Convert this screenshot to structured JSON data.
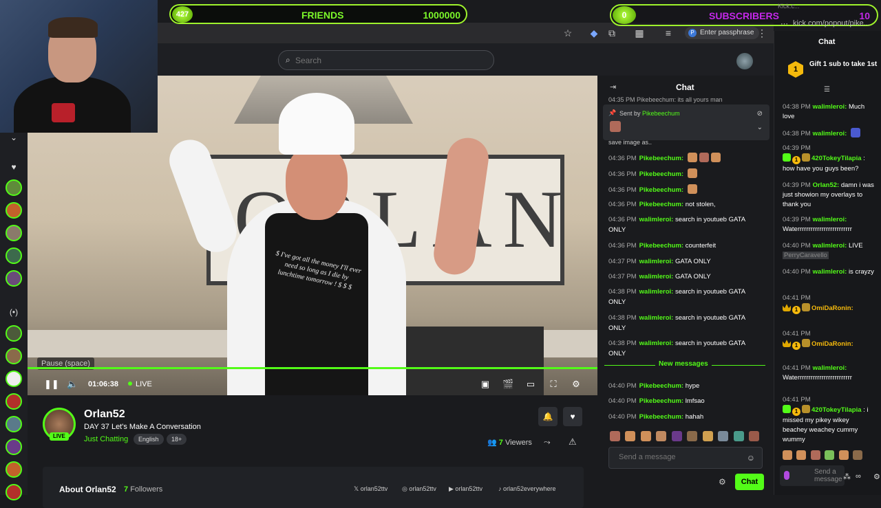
{
  "overlay": {
    "friends": {
      "badge": "427",
      "label": "FRIENDS",
      "goal": "1000000"
    },
    "subscribers": {
      "badge": "0",
      "label": "SUBSCRIBERS",
      "goal": "10"
    }
  },
  "browser": {
    "passphrase_label": "Enter passphrase",
    "popout_url": "kick.com/popout/pike...",
    "mini_tab": "Kick.c..."
  },
  "header": {
    "search_placeholder": "Search"
  },
  "player": {
    "tooltip": "Pause (space)",
    "time": "01:06:38",
    "live_label": "LIVE",
    "apron_text": "$ I've got all the money I'll ever need so long as I die by lunchtime tomorrow ! $ $ $",
    "sign_text": "ORLAN",
    "progress_percent": 100
  },
  "channel": {
    "name": "Orlan52",
    "live_pill": "LIVE",
    "title": "DAY 37 Let's Make A Conversation",
    "category": "Just Chatting",
    "tags": [
      "English",
      "18+"
    ],
    "viewers_count": "7",
    "viewers_label": "Viewers",
    "about_label": "About Orlan52",
    "followers_count": "7",
    "followers_label": "Followers",
    "socials": [
      {
        "icon": "x-icon",
        "handle": "orlan52ttv"
      },
      {
        "icon": "instagram-icon",
        "handle": "orlan52ttv"
      },
      {
        "icon": "youtube-icon",
        "handle": "orlan52ttv"
      },
      {
        "icon": "tiktok-icon",
        "handle": "orlan52everywhere"
      }
    ]
  },
  "inner_chat": {
    "title": "Chat",
    "top_line": "04:35 PM Pikebeechum: its all yours man",
    "pinned_prefix": "Sent by",
    "pinned_user": "Pikebeechum",
    "save_text": "save image as..",
    "messages": [
      {
        "time": "04:36 PM",
        "user": "Pikebeechum:",
        "text": "",
        "emotes": 3
      },
      {
        "time": "04:36 PM",
        "user": "Pikebeechum:",
        "text": "",
        "emotes": 1
      },
      {
        "time": "04:36 PM",
        "user": "Pikebeechum:",
        "text": "",
        "emotes": 1
      },
      {
        "time": "04:36 PM",
        "user": "Pikebeechum:",
        "text": "not stolen,",
        "emotes": 0
      },
      {
        "time": "04:36 PM",
        "user": "walimleroi:",
        "text": "search in youtueb GATA ONLY",
        "emotes": 0
      },
      {
        "time": "04:36 PM",
        "user": "Pikebeechum:",
        "text": "counterfeit",
        "emotes": 0
      },
      {
        "time": "04:37 PM",
        "user": "walimleroi:",
        "text": "GATA ONLY",
        "emotes": 0
      },
      {
        "time": "04:37 PM",
        "user": "walimleroi:",
        "text": "GATA ONLY",
        "emotes": 0
      },
      {
        "time": "04:38 PM",
        "user": "walimleroi:",
        "text": "search in youtueb GATA ONLY",
        "emotes": 0
      },
      {
        "time": "04:38 PM",
        "user": "walimleroi:",
        "text": "search in youtueb GATA ONLY",
        "emotes": 0
      },
      {
        "time": "04:38 PM",
        "user": "walimleroi:",
        "text": "search in youtueb GATA ONLY",
        "emotes": 0
      }
    ],
    "new_messages_label": "New messages",
    "new_messages": [
      {
        "time": "04:40 PM",
        "user": "Pikebeechum:",
        "text": "hype"
      },
      {
        "time": "04:40 PM",
        "user": "Pikebeechum:",
        "text": "lmfsao"
      },
      {
        "time": "04:40 PM",
        "user": "Pikebeechum:",
        "text": "hahah"
      }
    ],
    "input_placeholder": "Send a message",
    "send_label": "Chat"
  },
  "popout_chat": {
    "title": "Chat",
    "gift_badge": "1",
    "gift_text": "Gift 1 sub to take 1st",
    "messages": [
      {
        "time": "04:38 PM",
        "user": "walimleroi:",
        "text": "Much love"
      },
      {
        "time": "04:38 PM",
        "user": "walimleroi:",
        "text": ""
      },
      {
        "time": "04:39 PM",
        "user": "420TokeyTilapia",
        "text": ": how have you guys been?"
      },
      {
        "time": "04:39 PM",
        "user": "Orlan52:",
        "text": "damn i was just showion my overlays to thank you"
      },
      {
        "time": "04:39 PM",
        "user": "walimleroi:",
        "text": "Waterrrrrrrrrrrrrrrrrrrrrrrrr"
      },
      {
        "time": "04:40 PM",
        "user": "walimleroi:",
        "text": "LIVE",
        "highlight": "PerryCaravello"
      },
      {
        "time": "04:40 PM",
        "user": "walimleroi:",
        "text": "is crayzy"
      },
      {
        "time": "04:41 PM",
        "user": "OmiDaRonin:",
        "text": ""
      },
      {
        "time": "04:41 PM",
        "user": "OmiDaRonin:",
        "text": ""
      },
      {
        "time": "04:41 PM",
        "user": "walimleroi:",
        "text": "Waterrrrrrrrrrrrrrrrrrrrrrrrr"
      },
      {
        "time": "04:41 PM",
        "user": "420TokeyTilapia",
        "text": ": i missed my pikey wikey beachey weachey cummy wummy"
      }
    ],
    "input_placeholder": "Send a message",
    "badge_one": "1"
  },
  "colors": {
    "accent": "#53fc18",
    "overlay_sub": "#c428ea",
    "gold": "#f5b90c"
  }
}
